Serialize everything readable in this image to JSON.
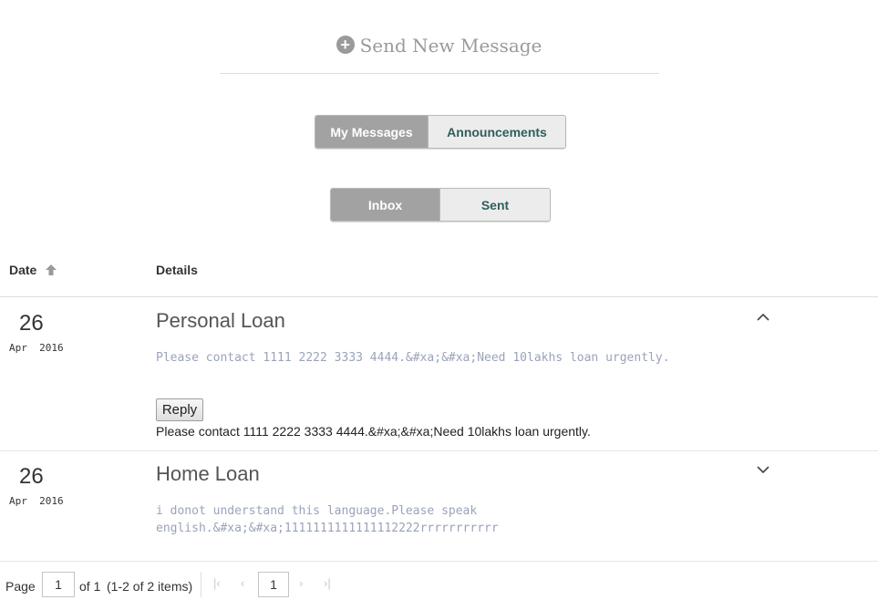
{
  "header": {
    "plus_icon": "plus-circle-icon",
    "send_new_label": "Send New Message"
  },
  "tabs_primary": {
    "items": [
      {
        "label": "My Messages",
        "active": true
      },
      {
        "label": "Announcements",
        "active": false
      }
    ]
  },
  "tabs_box": {
    "items": [
      {
        "label": "Inbox",
        "active": true
      },
      {
        "label": "Sent",
        "active": false
      }
    ]
  },
  "table": {
    "columns": [
      {
        "label": "Date",
        "sort": "ascending",
        "sort_icon": "arrow-up-icon"
      },
      {
        "label": "Details"
      }
    ],
    "rows": [
      {
        "day": "26",
        "month_year": "Apr  2016",
        "subject": "Personal Loan",
        "preview": "Please contact  1111 2222 3333 4444.&#xa;&#xa;Need 10lakhs loan urgently.",
        "expanded": true,
        "reply_label": "Reply",
        "full_text": "Please contact 1111 2222 3333 4444.&#xa;&#xa;Need 10lakhs loan urgently.",
        "toggle_icon": "chevron-up-icon"
      },
      {
        "day": "26",
        "month_year": "Apr  2016",
        "subject": "Home Loan",
        "preview": "i donot understand this language.Please speak english.&#xa;&#xa;1111111111111112222rrrrrrrrrrr",
        "expanded": false,
        "toggle_icon": "chevron-down-icon"
      }
    ]
  },
  "pager": {
    "page_label": "Page",
    "page_value": "1",
    "of_label": "of 1",
    "items_info": "(1-2 of 2 items)",
    "current_page": "1",
    "first_icon": "first-page-icon",
    "prev_icon": "prev-page-icon",
    "next_icon": "next-page-icon",
    "last_icon": "last-page-icon"
  },
  "colors": {
    "active_tab": "#a2a2a2",
    "inactive_tab_text": "#2e5f5c",
    "preview_text": "#9aa3ba",
    "muted": "#9a9a9a"
  }
}
